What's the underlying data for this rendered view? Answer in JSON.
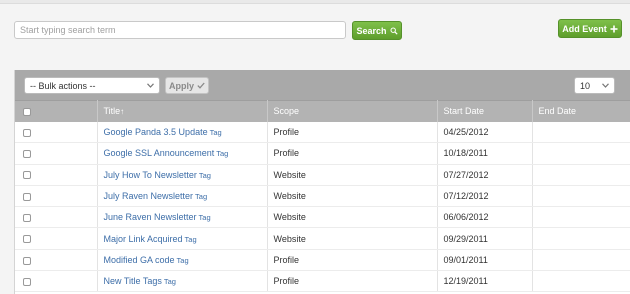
{
  "search": {
    "placeholder": "Start typing search term",
    "button_label": "Search"
  },
  "add_event": {
    "label": "Add Event"
  },
  "toolbar": {
    "bulk_actions": "-- Bulk actions --",
    "apply_label": "Apply",
    "page_size": "10"
  },
  "table": {
    "headers": {
      "title": "Title",
      "scope": "Scope",
      "start_date": "Start Date",
      "end_date": "End Date"
    },
    "tag_label": "Tag",
    "rows": [
      {
        "title": "Google Panda 3.5 Update",
        "scope": "Profile",
        "start": "04/25/2012",
        "end": ""
      },
      {
        "title": "Google SSL Announcement",
        "scope": "Profile",
        "start": "10/18/2011",
        "end": ""
      },
      {
        "title": "July How To Newsletter",
        "scope": "Website",
        "start": "07/27/2012",
        "end": ""
      },
      {
        "title": "July Raven Newsletter",
        "scope": "Website",
        "start": "07/12/2012",
        "end": ""
      },
      {
        "title": "June Raven Newsletter",
        "scope": "Website",
        "start": "06/06/2012",
        "end": ""
      },
      {
        "title": "Major Link Acquired",
        "scope": "Website",
        "start": "09/29/2011",
        "end": ""
      },
      {
        "title": "Modified GA code",
        "scope": "Profile",
        "start": "09/01/2011",
        "end": ""
      },
      {
        "title": "New Title Tags",
        "scope": "Profile",
        "start": "12/19/2011",
        "end": ""
      }
    ]
  },
  "icons": {
    "search": "search-icon",
    "add": "plus-icon",
    "apply": "checkmark-icon",
    "dropdown": "chevron-down-icon",
    "sort": "sort-up-icon"
  }
}
